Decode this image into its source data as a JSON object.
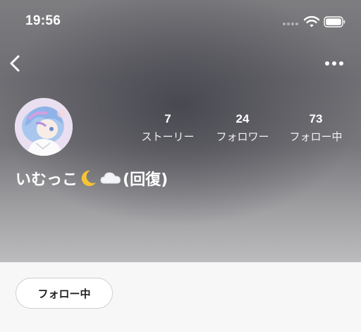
{
  "status_bar": {
    "time": "19:56"
  },
  "profile": {
    "name_text": "いむっこ",
    "name_suffix": "(回復)",
    "stats": [
      {
        "value": "7",
        "label": "ストーリー"
      },
      {
        "value": "24",
        "label": "フォロワー"
      },
      {
        "value": "73",
        "label": "フォロー中"
      }
    ]
  },
  "actions": {
    "follow_button_label": "フォロー中"
  },
  "icons": {
    "back": "chevron-left-icon",
    "more": "more-horizontal-icon",
    "moon": "crescent-moon-emoji",
    "cloud": "cloud-emoji"
  },
  "colors": {
    "header_text": "#ffffff",
    "button_border": "#cfcfd2",
    "page_background": "#f7f7f7"
  }
}
